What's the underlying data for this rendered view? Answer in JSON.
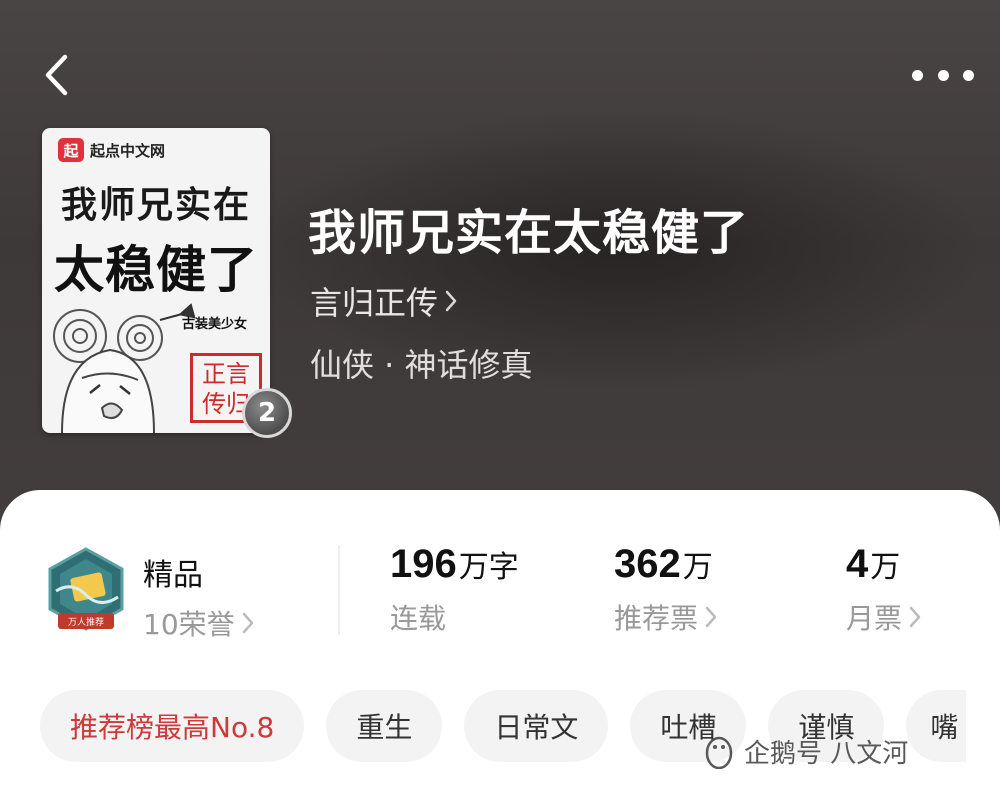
{
  "header": {
    "back_icon": "chevron-left-icon",
    "more_icon": "more-dots-icon"
  },
  "cover": {
    "publisher": "起点中文网",
    "publisher_logo_char": "起",
    "title_line_1": "我师兄实在",
    "title_line_2": "太稳健了",
    "tag": "古装美少女",
    "seal": "正言传归",
    "volume_number": "2"
  },
  "book": {
    "title": "我师兄实在太稳健了",
    "author": "言归正传",
    "genre": "仙侠 · 神话修真"
  },
  "honor": {
    "label": "精品",
    "count": "10荣誉",
    "badge_text": "万人推荐"
  },
  "stats": [
    {
      "value": "196",
      "unit": "万字",
      "label": "连载"
    },
    {
      "value": "362",
      "unit": "万",
      "label": "推荐票"
    },
    {
      "value": "4",
      "unit": "万",
      "label": "月票"
    }
  ],
  "tags": [
    "推荐榜最高No.8",
    "重生",
    "日常文",
    "吐槽",
    "谨慎",
    "嘴"
  ],
  "watermark": "企鹅号 八文河",
  "colors": {
    "hero_bg": "#3f3a3a",
    "rank_tag": "#cc3a3a",
    "seal_red": "#cf2a2a",
    "badge_teal": "#2f6f73"
  }
}
